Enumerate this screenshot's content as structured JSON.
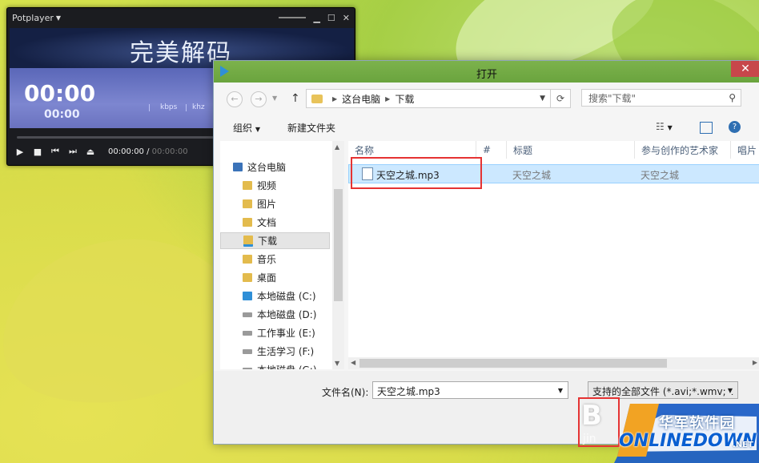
{
  "potplayer": {
    "title": "Potplayer",
    "banner": "完美解码",
    "time_big": "00:00",
    "time_small": "00:00",
    "kbps": "kbps",
    "khz": "khz",
    "time_current": "00:00:00",
    "time_sep": " / ",
    "time_total": "00:00:00"
  },
  "dialog": {
    "title": "打开",
    "close": "✕",
    "breadcrumb": [
      "这台电脑",
      "下载"
    ],
    "search_placeholder": "搜索\"下载\"",
    "toolbar": {
      "organize": "组织",
      "new_folder": "新建文件夹"
    },
    "nav_items": [
      {
        "label": "这台电脑",
        "icon": "computer-icon"
      },
      {
        "label": "视频",
        "icon": "folder-icon"
      },
      {
        "label": "图片",
        "icon": "folder-icon"
      },
      {
        "label": "文档",
        "icon": "folder-icon"
      },
      {
        "label": "下载",
        "icon": "download-folder-icon",
        "selected": true
      },
      {
        "label": "音乐",
        "icon": "folder-icon"
      },
      {
        "label": "桌面",
        "icon": "folder-icon"
      },
      {
        "label": "本地磁盘 (C:)",
        "icon": "windows-drive-icon"
      },
      {
        "label": "本地磁盘 (D:)",
        "icon": "drive-icon"
      },
      {
        "label": "工作事业 (E:)",
        "icon": "drive-icon"
      },
      {
        "label": "生活学习 (F:)",
        "icon": "drive-icon"
      },
      {
        "label": "本地磁盘 (G:)",
        "icon": "drive-icon"
      }
    ],
    "columns": [
      "名称",
      "#",
      "标题",
      "参与创作的艺术家",
      "唱片"
    ],
    "files": [
      {
        "name": "天空之城.mp3",
        "number": "",
        "title": "天空之城",
        "artist": "天空之城"
      }
    ],
    "filename_label": "文件名(N):",
    "filename_value": "天空之城.mp3",
    "filetype_value": "支持的全部文件 (*.avi;*.wmv;*."
  },
  "watermark": {
    "cn_text": "华军软件园",
    "brand": "ONLINEDOWN",
    "net": ".NET"
  },
  "colors": {
    "accent": "#6aa43e",
    "selection": "#cce8ff",
    "highlight": "#e53333"
  }
}
